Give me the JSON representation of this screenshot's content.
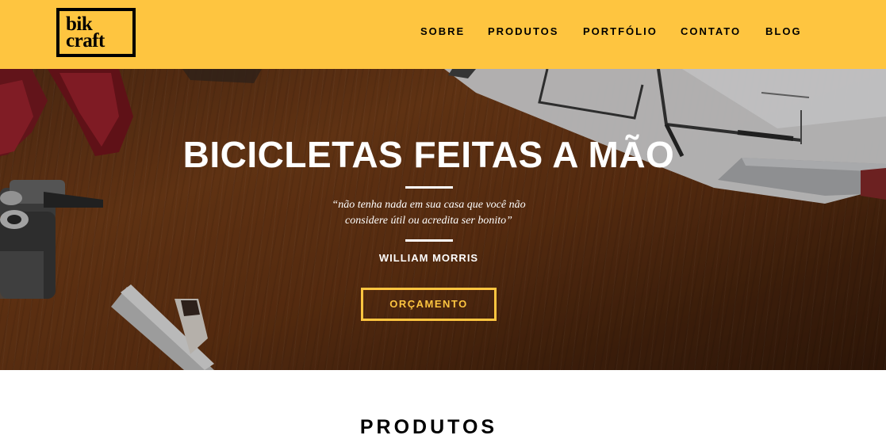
{
  "brand": {
    "logo_line1": "bik",
    "logo_line2": "craft"
  },
  "nav": {
    "items": [
      {
        "label": "SOBRE"
      },
      {
        "label": "PRODUTOS"
      },
      {
        "label": "PORTFÓLIO"
      },
      {
        "label": "CONTATO"
      },
      {
        "label": "BLOG"
      }
    ]
  },
  "hero": {
    "title": "BICICLETAS FEITAS A MÃO",
    "quote_line1": "“não tenha nada em sua casa que você não",
    "quote_line2": "considere útil ou acredita ser bonito”",
    "author": "WILLIAM MORRIS",
    "button_label": "ORÇAMENTO"
  },
  "section": {
    "title": "PRODUTOS"
  },
  "colors": {
    "accent": "#fec540",
    "text": "#000000",
    "hero_text": "#ffffff"
  }
}
